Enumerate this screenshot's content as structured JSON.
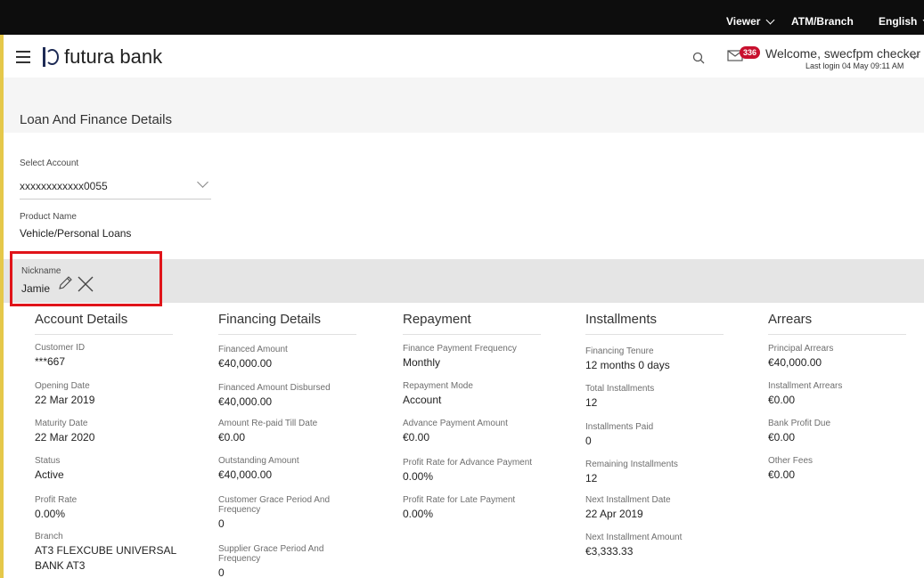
{
  "topbar": {
    "viewer": "Viewer",
    "atm_branch": "ATM/Branch",
    "language": "English"
  },
  "header": {
    "brand": "futura bank",
    "mail_count": "336",
    "welcome": "Welcome, swecfpm checker",
    "last_login": "Last login 04 May 09:11 AM"
  },
  "page": {
    "title": "Loan And Finance Details",
    "select_account_label": "Select Account",
    "select_account_value": "xxxxxxxxxxxx0055",
    "product_name_label": "Product Name",
    "product_name_value": "Vehicle/Personal Loans",
    "nickname_label": "Nickname",
    "nickname_value": "Jamie"
  },
  "sections": {
    "account": {
      "title": "Account Details",
      "fields": [
        {
          "label": "Customer ID",
          "value": "***667"
        },
        {
          "label": "Opening Date",
          "value": "22 Mar 2019"
        },
        {
          "label": "Maturity Date",
          "value": "22 Mar 2020"
        },
        {
          "label": "Status",
          "value": "Active"
        },
        {
          "label": "Profit Rate",
          "value": "0.00%"
        },
        {
          "label": "Branch",
          "value": "AT3 FLEXCUBE UNIVERSAL",
          "value2": "BANK AT3"
        }
      ]
    },
    "financing": {
      "title": "Financing Details",
      "fields": [
        {
          "label": "Financed Amount",
          "value": "€40,000.00"
        },
        {
          "label": "Financed Amount Disbursed",
          "value": "€40,000.00"
        },
        {
          "label": "Amount Re-paid Till Date",
          "value": "€0.00"
        },
        {
          "label": "Outstanding Amount",
          "value": "€40,000.00"
        },
        {
          "label": "Customer Grace Period And",
          "label2": "Frequency",
          "value": "0"
        },
        {
          "label": "Supplier Grace Period And",
          "label2": "Frequency",
          "value": "0"
        }
      ]
    },
    "repayment": {
      "title": "Repayment",
      "fields": [
        {
          "label": "Finance Payment Frequency",
          "value": "Monthly"
        },
        {
          "label": "Repayment Mode",
          "value": "Account"
        },
        {
          "label": "Advance Payment Amount",
          "value": "€0.00"
        },
        {
          "label": "Profit Rate for Advance Payment",
          "value": "0.00%"
        },
        {
          "label": "Profit Rate for Late Payment",
          "value": "0.00%"
        }
      ]
    },
    "installments": {
      "title": "Installments",
      "fields": [
        {
          "label": "Financing Tenure",
          "value": "12 months 0 days"
        },
        {
          "label": "Total Installments",
          "value": "12"
        },
        {
          "label": "Installments Paid",
          "value": "0"
        },
        {
          "label": "Remaining Installments",
          "value": "12"
        },
        {
          "label": "Next Installment Date",
          "value": "22 Apr 2019"
        },
        {
          "label": "Next Installment Amount",
          "value": "€3,333.33"
        }
      ]
    },
    "arrears": {
      "title": "Arrears",
      "fields": [
        {
          "label": "Principal Arrears",
          "value": "€40,000.00"
        },
        {
          "label": "Installment Arrears",
          "value": "€0.00"
        },
        {
          "label": "Bank Profit Due",
          "value": "€0.00"
        },
        {
          "label": "Other Fees",
          "value": "€0.00"
        }
      ]
    }
  }
}
